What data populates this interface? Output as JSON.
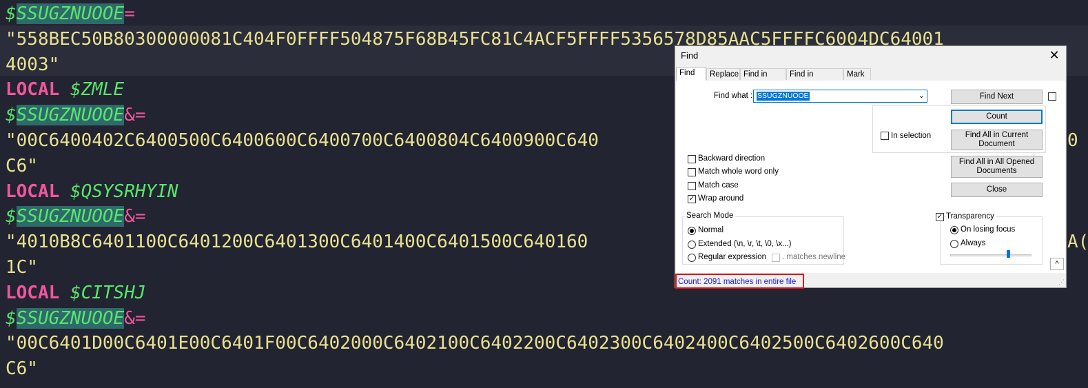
{
  "editor": {
    "lines": [
      {
        "type": "assign",
        "var": "$SSUGZNUOOE",
        "op": "="
      },
      {
        "type": "string",
        "text": "\"558BEC50B80300000081C404F0FFFF504875F68B45FC81C4ACF5FFFF5356578D85AAC5FFFFC6004DC64001"
      },
      {
        "type": "string",
        "text": "4003\""
      },
      {
        "type": "local",
        "kw": "LOCAL",
        "var": "$ZMLE"
      },
      {
        "type": "assign",
        "var": "$SSUGZNUOOE",
        "op": "&="
      },
      {
        "type": "string",
        "text": "\"00C6400402C6400500C6400600C6400700C6400804C6400900C640"
      },
      {
        "type": "string",
        "text": "C6\""
      },
      {
        "type": "local",
        "kw": "LOCAL",
        "var": "$QSYSRHYIN"
      },
      {
        "type": "assign",
        "var": "$SSUGZNUOOE",
        "op": "&="
      },
      {
        "type": "string",
        "text": "\"4010B8C6401100C6401200C6401300C6401400C6401500C640160"
      },
      {
        "type": "string",
        "text": "1C\""
      },
      {
        "type": "local",
        "kw": "LOCAL",
        "var": "$CITSHJ"
      },
      {
        "type": "assign",
        "var": "$SSUGZNUOOE",
        "op": "&="
      },
      {
        "type": "string",
        "text": "\"00C6401D00C6401E00C6401F00C6402000C6402100C6402200C6402300C6402400C6402500C6402600C640"
      },
      {
        "type": "string",
        "text": "C6\""
      }
    ],
    "right_fragments": [
      "0",
      "A("
    ]
  },
  "dialog": {
    "title": "Find",
    "close": "✕",
    "tabs": [
      "Find",
      "Replace",
      "Find in Files",
      "Find in Projects",
      "Mark"
    ],
    "find_what_label": "Find what :",
    "find_what_value": "SSUGZNUOOE",
    "buttons": {
      "find_next": "Find Next",
      "count": "Count",
      "find_all_current": "Find All in Current Document",
      "find_all_opened": "Find All in All Opened Documents",
      "close": "Close"
    },
    "in_selection": "In selection",
    "options": {
      "backward": {
        "label": "Backward direction",
        "checked": false
      },
      "whole_word": {
        "label": "Match whole word only",
        "checked": false
      },
      "match_case": {
        "label": "Match case",
        "checked": false
      },
      "wrap_around": {
        "label": "Wrap around",
        "checked": true
      }
    },
    "search_mode": {
      "title": "Search Mode",
      "normal": "Normal",
      "extended": "Extended (\\n, \\r, \\t, \\0, \\x...)",
      "regex": "Regular expression",
      "matches_newline": ". matches newline",
      "selected": "normal"
    },
    "transparency": {
      "label": "Transparency",
      "checked": true,
      "on_losing_focus": "On losing focus",
      "always": "Always",
      "selected": "on_losing_focus",
      "level": 0.72
    },
    "collapse": "^",
    "status": "Count: 2091 matches in entire file"
  }
}
